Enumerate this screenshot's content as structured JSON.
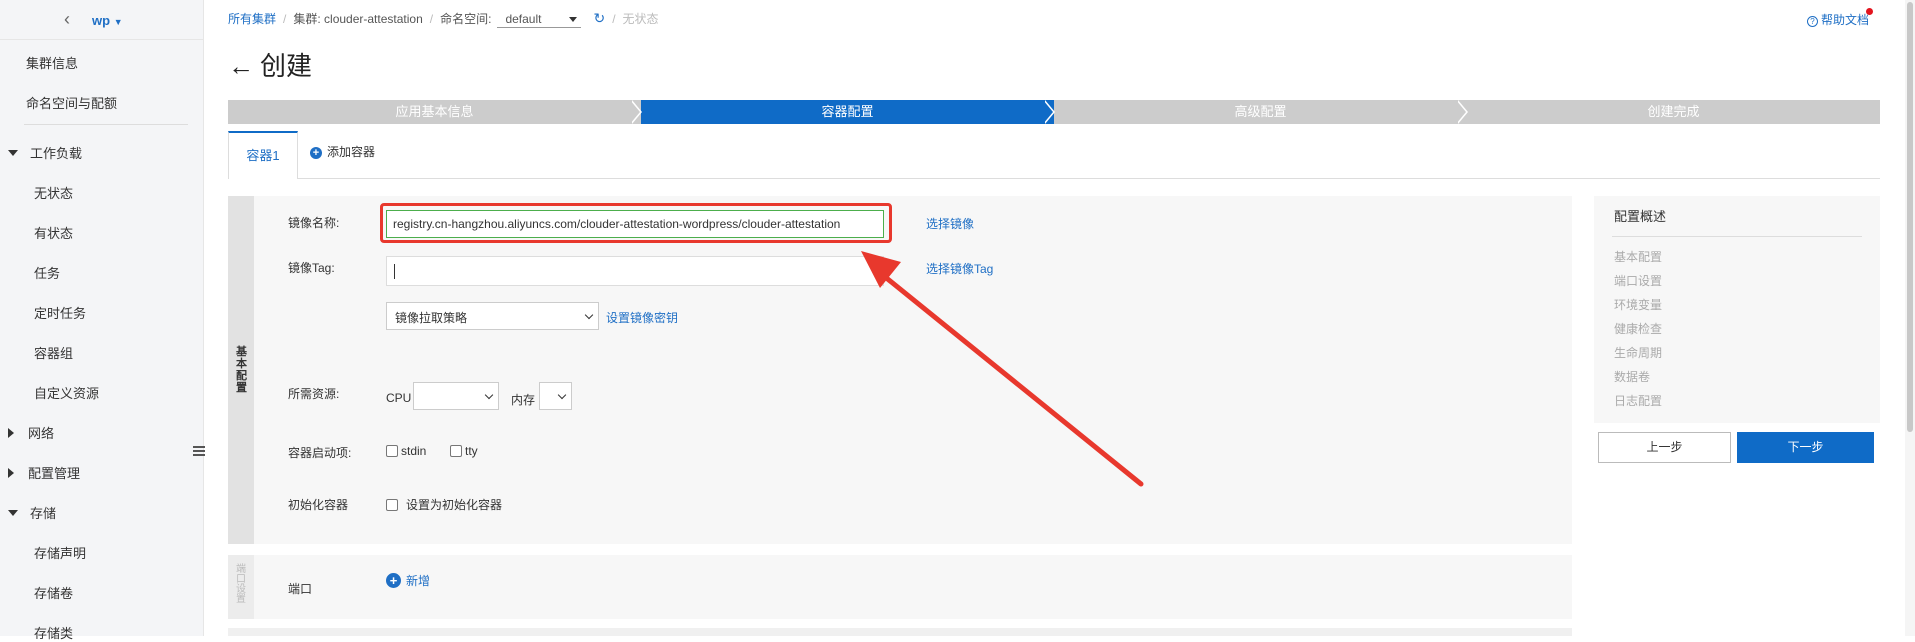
{
  "sidebar": {
    "cluster_name": "wp",
    "items": [
      {
        "label": "集群信息"
      },
      {
        "label": "命名空间与配额"
      },
      {
        "label": "工作负载"
      },
      {
        "label": "无状态"
      },
      {
        "label": "有状态"
      },
      {
        "label": "任务"
      },
      {
        "label": "定时任务"
      },
      {
        "label": "容器组"
      },
      {
        "label": "自定义资源"
      },
      {
        "label": "网络"
      },
      {
        "label": "配置管理"
      },
      {
        "label": "存储"
      },
      {
        "label": "存储声明"
      },
      {
        "label": "存储卷"
      },
      {
        "label": "存储类"
      }
    ]
  },
  "breadcrumb": {
    "all_clusters": "所有集群",
    "cluster_label": "集群: clouder-attestation",
    "namespace_label": "命名空间:",
    "namespace_value": "default",
    "stateless": "无状态"
  },
  "help": {
    "label": "帮助文档"
  },
  "page": {
    "title": "创建"
  },
  "steps": [
    {
      "label": "应用基本信息",
      "active": false
    },
    {
      "label": "容器配置",
      "active": true
    },
    {
      "label": "高级配置",
      "active": false
    },
    {
      "label": "创建完成",
      "active": false
    }
  ],
  "tabs": {
    "container1": "容器1",
    "add_container": "添加容器"
  },
  "form": {
    "section_basic": "基本配置",
    "image_name_label": "镜像名称:",
    "image_name_value": "registry.cn-hangzhou.aliyuncs.com/clouder-attestation-wordpress/clouder-attestation",
    "select_image": "选择镜像",
    "image_tag_label": "镜像Tag:",
    "select_image_tag": "选择镜像Tag",
    "pull_policy": "镜像拉取策略",
    "set_image_secret": "设置镜像密钥",
    "resources_label": "所需资源:",
    "cpu_label": "CPU",
    "memory_label": "内存",
    "startup_label": "容器启动项:",
    "stdin": "stdin",
    "tty": "tty",
    "init_container_label": "初始化容器",
    "init_container_checkbox": "设置为初始化容器",
    "section_port": "端口设置",
    "port_label": "端口",
    "port_add": "新增"
  },
  "summary": {
    "title": "配置概述",
    "items": [
      "基本配置",
      "端口设置",
      "环境变量",
      "健康检查",
      "生命周期",
      "数据卷",
      "日志配置"
    ]
  },
  "buttons": {
    "prev": "上一步",
    "next": "下一步"
  },
  "colors": {
    "primary": "#0f6bc7",
    "link": "#1f6fc5",
    "annotation_red": "#e8382d",
    "input_focus_green": "#4cae4c"
  }
}
